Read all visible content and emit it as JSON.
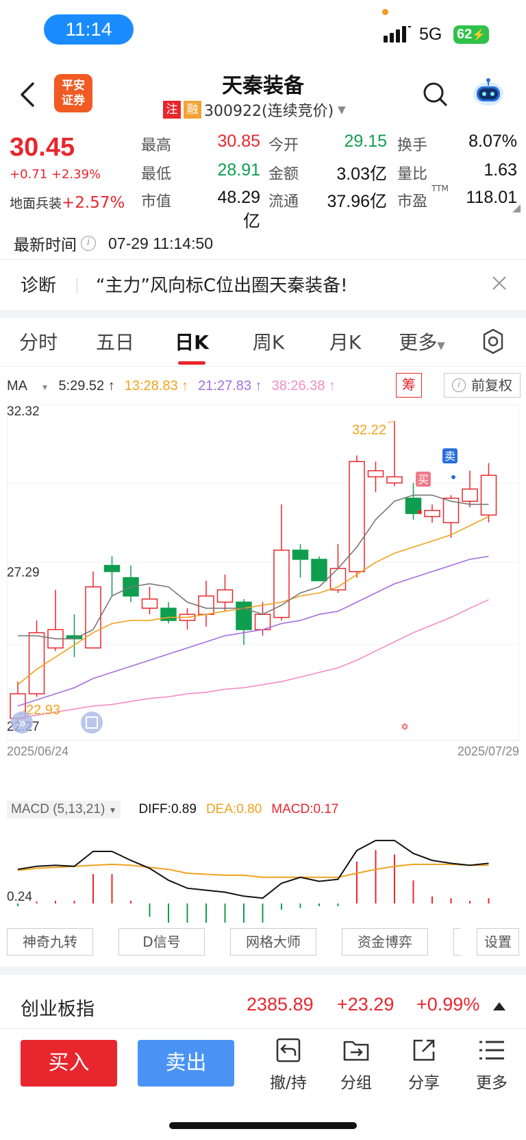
{
  "status_bar": {
    "time": "11:14",
    "network": "5G",
    "battery": "62"
  },
  "header": {
    "title": "天秦装备",
    "logo_text": "平安证券",
    "badge_zhu": "注",
    "badge_rong": "融",
    "code_line": "300922(连续竞价)"
  },
  "quote": {
    "price": "30.45",
    "change": "+0.71 +2.39%",
    "sector_name": "地面兵装",
    "sector_change": "+2.57%",
    "rows": [
      [
        {
          "label": "最高",
          "value": "30.85",
          "color": "#e8262d"
        },
        {
          "label": "今开",
          "value": "29.15",
          "color": "#0f9e4f"
        },
        {
          "label": "换手",
          "value": "8.07%",
          "color": "#111111"
        }
      ],
      [
        {
          "label": "最低",
          "value": "28.91",
          "color": "#0f9e4f"
        },
        {
          "label": "金额",
          "value": "3.03亿",
          "color": "#111111"
        },
        {
          "label": "量比",
          "value": "1.63",
          "color": "#111111"
        }
      ],
      [
        {
          "label": "市值",
          "value": "48.29亿",
          "color": "#111111"
        },
        {
          "label": "流通",
          "value": "37.96亿",
          "color": "#111111"
        },
        {
          "label": "市盈",
          "value": "118.01",
          "color": "#111111"
        }
      ]
    ],
    "pe_sup": "TTM"
  },
  "latest": {
    "label": "最新时间",
    "value": "07-29 11:14:50"
  },
  "diagnosis": {
    "label": "诊断",
    "text": "“主力”风向标C位出圈天秦装备!"
  },
  "tabs": [
    "分时",
    "五日",
    "日K",
    "周K",
    "月K",
    "更多"
  ],
  "active_tab": "日K",
  "ma": {
    "label": "MA",
    "items": [
      {
        "text": "5:29.52",
        "color": "#333333"
      },
      {
        "text": "13:28.83",
        "color": "#f0a21c"
      },
      {
        "text": "21:27.83",
        "color": "#a56ee0"
      },
      {
        "text": "38:26.38",
        "color": "#f48cc4"
      }
    ],
    "chip_label": "筹",
    "fuquan_label": "前复权"
  },
  "chart_data": {
    "type": "candlestick",
    "title": "",
    "xlabel": "",
    "ylabel": "",
    "ylim": [
      22.27,
      32.32
    ],
    "y_ticks": [
      "32.32",
      "27.29",
      "22.27"
    ],
    "x_start": "2025/06/24",
    "x_end": "2025/07/29",
    "high_annotation": "32.22",
    "low_annotation": "22.93",
    "buy_marker": "买",
    "sell_marker": "卖",
    "candles": [
      {
        "o": 22.5,
        "c": 23.3,
        "h": 23.7,
        "l": 22.4
      },
      {
        "o": 23.3,
        "c": 25.3,
        "h": 25.7,
        "l": 23.2
      },
      {
        "o": 24.8,
        "c": 25.4,
        "h": 26.7,
        "l": 24.7
      },
      {
        "o": 25.2,
        "c": 25.1,
        "h": 25.9,
        "l": 24.5
      },
      {
        "o": 24.8,
        "c": 26.8,
        "h": 27.3,
        "l": 24.8
      },
      {
        "o": 27.5,
        "c": 27.3,
        "h": 27.8,
        "l": 26.5
      },
      {
        "o": 27.1,
        "c": 26.5,
        "h": 27.5,
        "l": 26.3
      },
      {
        "o": 26.1,
        "c": 26.4,
        "h": 26.8,
        "l": 25.9
      },
      {
        "o": 26.1,
        "c": 25.7,
        "h": 26.3,
        "l": 25.6
      },
      {
        "o": 25.7,
        "c": 25.9,
        "h": 26.1,
        "l": 25.4
      },
      {
        "o": 25.9,
        "c": 26.5,
        "h": 27.0,
        "l": 25.5
      },
      {
        "o": 26.3,
        "c": 26.7,
        "h": 27.2,
        "l": 26.0
      },
      {
        "o": 26.3,
        "c": 25.4,
        "h": 26.4,
        "l": 24.9
      },
      {
        "o": 25.4,
        "c": 25.9,
        "h": 26.3,
        "l": 25.2
      },
      {
        "o": 25.8,
        "c": 28.0,
        "h": 29.5,
        "l": 25.7
      },
      {
        "o": 28.0,
        "c": 27.7,
        "h": 28.2,
        "l": 27.1
      },
      {
        "o": 27.7,
        "c": 27.0,
        "h": 27.8,
        "l": 27.0
      },
      {
        "o": 26.7,
        "c": 27.4,
        "h": 28.2,
        "l": 26.6
      },
      {
        "o": 27.3,
        "c": 30.9,
        "h": 31.1,
        "l": 27.1
      },
      {
        "o": 30.4,
        "c": 30.6,
        "h": 30.9,
        "l": 29.9
      },
      {
        "o": 30.2,
        "c": 30.4,
        "h": 32.22,
        "l": 30.1
      },
      {
        "o": 29.7,
        "c": 29.2,
        "h": 30.2,
        "l": 29.0
      },
      {
        "o": 29.1,
        "c": 29.3,
        "h": 29.5,
        "l": 28.9
      },
      {
        "o": 28.9,
        "c": 29.7,
        "h": 29.8,
        "l": 28.4
      },
      {
        "o": 29.6,
        "c": 30.0,
        "h": 30.6,
        "l": 29.4
      },
      {
        "o": 29.15,
        "c": 30.45,
        "h": 30.85,
        "l": 28.91
      }
    ],
    "ma5": [
      25.2,
      25.2,
      25.1,
      25.1,
      25.4,
      26.5,
      26.8,
      26.9,
      26.8,
      26.3,
      26.1,
      26.1,
      26.1,
      25.9,
      26.2,
      26.6,
      26.8,
      27.4,
      28.1,
      29.0,
      29.6,
      29.8,
      29.8,
      29.6,
      29.5,
      29.5
    ],
    "ma13": [
      23.6,
      24.1,
      24.5,
      24.9,
      25.3,
      25.6,
      25.7,
      25.7,
      25.8,
      25.8,
      25.9,
      26.0,
      26.1,
      26.2,
      26.3,
      26.5,
      26.6,
      26.8,
      27.2,
      27.6,
      27.9,
      28.1,
      28.3,
      28.5,
      28.8,
      29.1
    ],
    "ma21": [
      22.9,
      23.1,
      23.3,
      23.5,
      23.8,
      24.0,
      24.2,
      24.4,
      24.6,
      24.8,
      25.0,
      25.2,
      25.3,
      25.4,
      25.6,
      25.7,
      25.9,
      26.0,
      26.3,
      26.6,
      26.9,
      27.1,
      27.3,
      27.5,
      27.7,
      27.8
    ],
    "ma38": [
      22.5,
      22.6,
      22.7,
      22.8,
      22.9,
      22.95,
      23.05,
      23.15,
      23.2,
      23.3,
      23.35,
      23.45,
      23.5,
      23.6,
      23.7,
      23.85,
      24.0,
      24.15,
      24.4,
      24.7,
      25.0,
      25.3,
      25.55,
      25.8,
      26.1,
      26.38
    ]
  },
  "macd": {
    "selector": "MACD (5,13,21)",
    "diff": "DIFF:0.89",
    "dea": "DEA:0.80",
    "macd": "MACD:0.17",
    "axis_label": "0.24",
    "diff_series": [
      0.83,
      0.86,
      0.87,
      0.86,
      1.01,
      1.01,
      0.92,
      0.84,
      0.72,
      0.64,
      0.62,
      0.6,
      0.56,
      0.54,
      0.69,
      0.75,
      0.71,
      0.73,
      1.02,
      1.12,
      1.12,
      0.99,
      0.92,
      0.89,
      0.87,
      0.89
    ],
    "dea_series": [
      0.82,
      0.84,
      0.85,
      0.86,
      0.87,
      0.88,
      0.87,
      0.85,
      0.83,
      0.79,
      0.78,
      0.77,
      0.77,
      0.75,
      0.75,
      0.75,
      0.75,
      0.75,
      0.79,
      0.83,
      0.86,
      0.88,
      0.88,
      0.88,
      0.87,
      0.87
    ],
    "hist": [
      -0.03,
      0.02,
      0.03,
      0.03,
      0.33,
      0.33,
      0.03,
      -0.15,
      -0.33,
      -0.34,
      -0.29,
      -0.24,
      -0.45,
      -0.46,
      -0.07,
      -0.05,
      -0.03,
      -0.03,
      0.47,
      0.6,
      0.55,
      0.26,
      0.08,
      0.06,
      0.03,
      0.06
    ]
  },
  "indicators": [
    "神奇九转",
    "D信号",
    "网格大师",
    "资金博弈",
    "设置"
  ],
  "index_bar": {
    "name": "创业板指",
    "value": "2385.89",
    "change": "+23.29",
    "pct": "+0.99%"
  },
  "toolbar": {
    "buy": "买入",
    "sell": "卖出",
    "tools": [
      {
        "label": "撤/持",
        "icon": "withdraw-icon"
      },
      {
        "label": "分组",
        "icon": "group-icon"
      },
      {
        "label": "分享",
        "icon": "share-icon"
      },
      {
        "label": "更多",
        "icon": "more-icon"
      }
    ]
  },
  "colors": {
    "up": "#e8262d",
    "down": "#0f9e4f",
    "accent": "#1a8cff",
    "sell": "#4a93f5"
  }
}
